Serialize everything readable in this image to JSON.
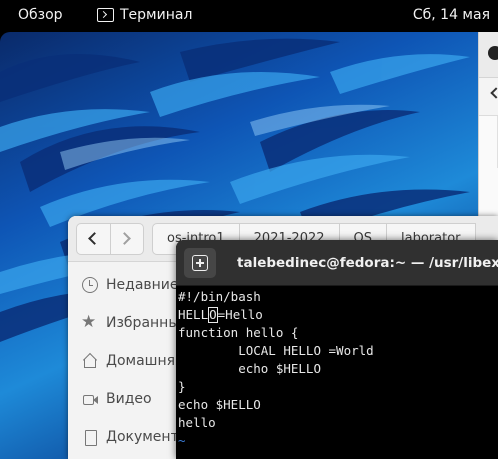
{
  "topbar": {
    "overview_label": "Обзор",
    "app_label": "Терминал",
    "clock": "Сб, 14 мая"
  },
  "file_manager": {
    "breadcrumbs": [
      "os-intro1",
      "2021-2022",
      "OS",
      "laborator"
    ],
    "sidebar": [
      {
        "label": "Недавние",
        "icon": "clock-icon"
      },
      {
        "label": "Избранные",
        "icon": "star-icon"
      },
      {
        "label": "Домашняя",
        "icon": "home-icon"
      },
      {
        "label": "Видео",
        "icon": "video-icon"
      },
      {
        "label": "Документы",
        "icon": "document-icon"
      }
    ]
  },
  "terminal": {
    "title": "talebedinec@fedora:~ — /usr/libexec/vi",
    "lines": {
      "l1": "#!/bin/bash",
      "l2_before": "HELL",
      "l2_cursor": "O",
      "l2_after": "=Hello",
      "l3": "function hello {",
      "l4": "        LOCAL HELLO =World",
      "l5": "        echo $HELLO",
      "l6": "}",
      "l7": "echo $HELLO",
      "l8": "hello",
      "l9": "~"
    }
  },
  "colors": {
    "topbar_bg": "#000000",
    "terminal_bg": "#000000",
    "terminal_header": "#303030",
    "vim_tilde": "#3a7bd5"
  }
}
